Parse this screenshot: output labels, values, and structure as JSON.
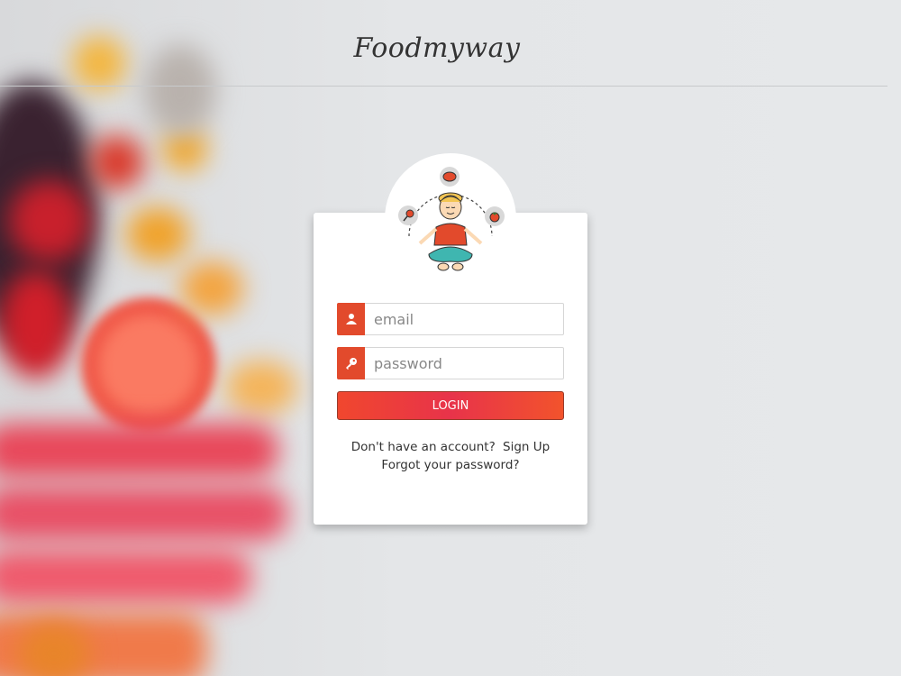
{
  "brand": "Foodmyway",
  "form": {
    "email_placeholder": "email",
    "password_placeholder": "password",
    "login_label": "LOGIN"
  },
  "links": {
    "no_account_text": "Don't have an account?",
    "sign_up": "Sign Up",
    "forgot_password": "Forgot your password?"
  },
  "icons": {
    "email": "user-icon",
    "password": "key-icon"
  },
  "colors": {
    "accent": "#e24a2c",
    "button_start": "#f0472e",
    "button_mid": "#e8334a"
  }
}
